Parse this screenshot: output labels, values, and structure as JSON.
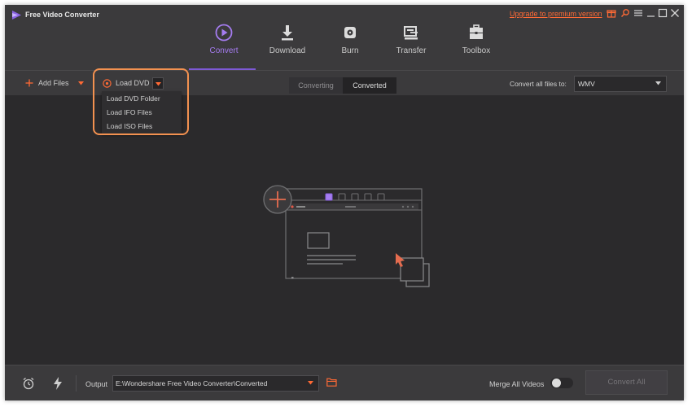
{
  "app": {
    "title": "Free Video Converter",
    "upgrade_label": "Upgrade to premium version"
  },
  "title_icons": [
    "gift-icon",
    "search-icon",
    "menu-icon",
    "minimize-icon",
    "maximize-icon",
    "close-icon"
  ],
  "nav": {
    "tabs": [
      {
        "label": "Convert",
        "icon": "convert-icon",
        "active": true
      },
      {
        "label": "Download",
        "icon": "download-icon",
        "active": false
      },
      {
        "label": "Burn",
        "icon": "burn-icon",
        "active": false
      },
      {
        "label": "Transfer",
        "icon": "transfer-icon",
        "active": false
      },
      {
        "label": "Toolbox",
        "icon": "toolbox-icon",
        "active": false
      }
    ]
  },
  "toolbar": {
    "add_files_label": "Add Files",
    "load_dvd_label": "Load DVD",
    "segments": [
      "Converting",
      "Converted"
    ],
    "active_segment": "Converting",
    "convert_all_label": "Convert all files to:",
    "format_value": "WMV"
  },
  "dvd_menu": {
    "items": [
      "Load DVD Folder",
      "Load IFO Files",
      "Load ISO Files"
    ]
  },
  "bottom": {
    "output_label": "Output",
    "output_path": "E:\\Wondershare Free Video Converter\\Converted",
    "merge_label": "Merge All Videos",
    "merge_enabled": false,
    "convert_all_button": "Convert All"
  },
  "colors": {
    "accent": "#7d59d6",
    "active_tab": "#a57cf0",
    "upgrade_link": "#ff6a35",
    "highlight": "#f39150",
    "background": "#2b2a2c"
  }
}
